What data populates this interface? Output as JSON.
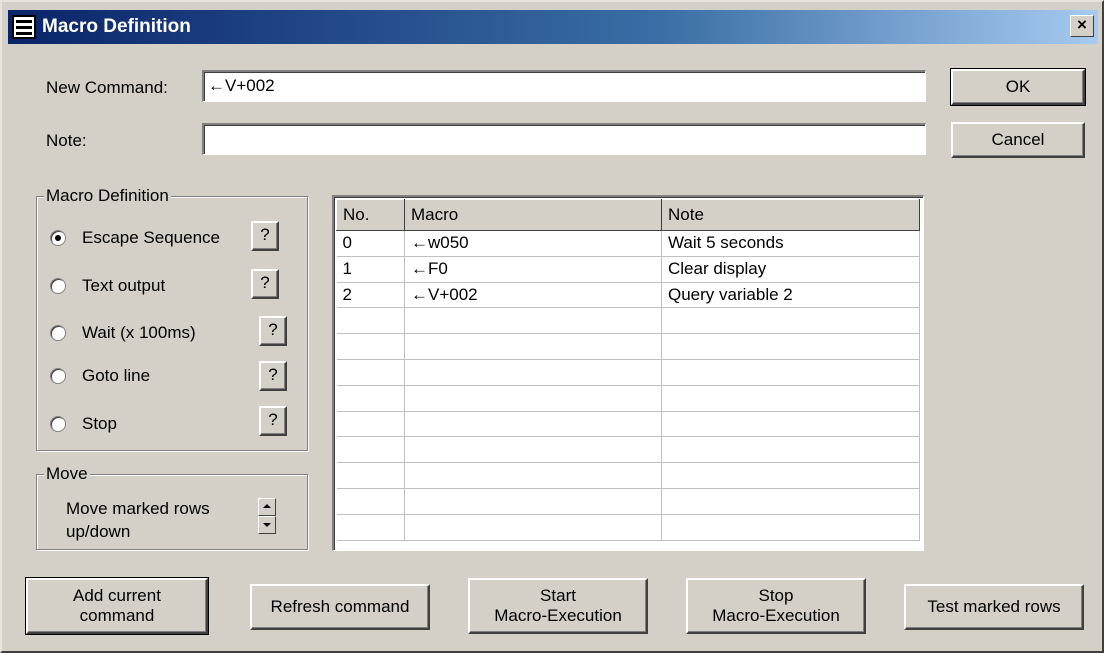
{
  "window": {
    "title": "Macro Definition",
    "close_label": "×"
  },
  "form": {
    "new_command_label": "New Command:",
    "new_command_value": "←V+002",
    "note_label": "Note:",
    "note_value": ""
  },
  "buttons": {
    "ok": "OK",
    "cancel": "Cancel"
  },
  "macro_definition": {
    "legend": "Macro Definition",
    "selected": "Escape Sequence",
    "options": [
      {
        "label": "Escape Sequence",
        "help": "?"
      },
      {
        "label": "Text output",
        "help": "?"
      },
      {
        "label": "Wait (x 100ms)",
        "help": "?"
      },
      {
        "label": "Goto line",
        "help": "?"
      },
      {
        "label": "Stop",
        "help": "?"
      }
    ]
  },
  "move": {
    "legend": "Move",
    "label_line1": "Move marked rows",
    "label_line2": "up/down"
  },
  "table": {
    "headers": [
      "No.",
      "Macro",
      "Note"
    ],
    "rows": [
      [
        "0",
        "←w050",
        "Wait 5 seconds"
      ],
      [
        "1",
        "←F0",
        "Clear display"
      ],
      [
        "2",
        "←V+002",
        "Query variable 2"
      ]
    ]
  },
  "bottom_buttons": {
    "add_line1": "Add current",
    "add_line2": "command",
    "refresh": "Refresh command",
    "start_line1": "Start",
    "start_line2": "Macro-Execution",
    "stop_line1": "Stop",
    "stop_line2": "Macro-Execution",
    "test": "Test marked rows"
  },
  "colors": {
    "dialog_face": "#d4d0c8",
    "titlebar_start": "#0a246a",
    "titlebar_end": "#a6caf0"
  }
}
